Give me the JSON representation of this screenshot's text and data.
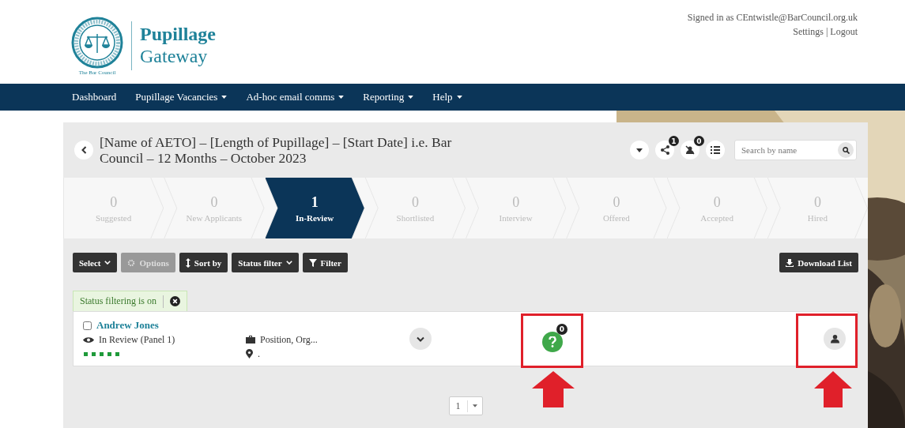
{
  "logo": {
    "caption": "The Bar Council",
    "title_line1": "Pupillage",
    "title_line2": "Gateway"
  },
  "account": {
    "signed_in": "Signed in as CEntwistle@BarCouncil.org.uk",
    "links": [
      "Settings",
      "Logout"
    ],
    "separator": "|"
  },
  "nav": [
    {
      "label": "Dashboard",
      "dropdown": false
    },
    {
      "label": "Pupillage Vacancies",
      "dropdown": true
    },
    {
      "label": "Ad-hoc email comms",
      "dropdown": true
    },
    {
      "label": "Reporting",
      "dropdown": true
    },
    {
      "label": "Help",
      "dropdown": true
    }
  ],
  "vacancy": {
    "title": "[Name of AETO] – [Length of Pupillage] – [Start Date] i.e. Bar Council – 12 Months – October 2023",
    "share_count": "1",
    "hidden_count": "0",
    "search": {
      "placeholder": "Search by name"
    }
  },
  "stages": [
    {
      "count": "0",
      "label": "Suggested",
      "selected": false
    },
    {
      "count": "0",
      "label": "New Applicants",
      "selected": false
    },
    {
      "count": "1",
      "label": "In-Review",
      "selected": true
    },
    {
      "count": "0",
      "label": "Shortlisted",
      "selected": false
    },
    {
      "count": "0",
      "label": "Interview",
      "selected": false
    },
    {
      "count": "0",
      "label": "Offered",
      "selected": false
    },
    {
      "count": "0",
      "label": "Accepted",
      "selected": false
    },
    {
      "count": "0",
      "label": "Hired",
      "selected": false
    }
  ],
  "toolbar": [
    {
      "label": "Select",
      "kind": "dropdown",
      "disabled": false
    },
    {
      "label": "Options",
      "kind": "gear",
      "disabled": true
    },
    {
      "label": "Sort by",
      "kind": "sort",
      "disabled": false
    },
    {
      "label": "Status filter",
      "kind": "dropdown",
      "disabled": false
    },
    {
      "label": "Filter",
      "kind": "filter",
      "disabled": false
    }
  ],
  "download": "Download List",
  "filter_tag": "Status filtering is on",
  "applicants": [
    {
      "name": "Andrew Jones",
      "checked": false,
      "status": "In Review (Panel 1)",
      "position": "Position, Org...",
      "location": ".",
      "question_count": "0"
    }
  ],
  "pagination": {
    "page": "1"
  }
}
